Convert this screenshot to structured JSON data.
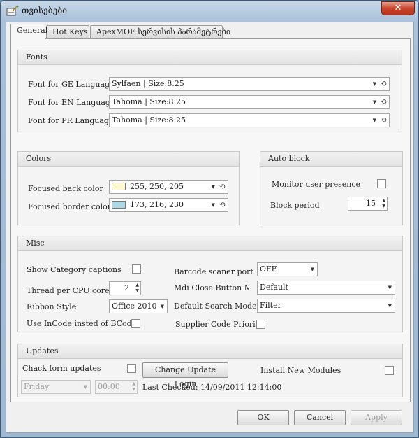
{
  "window": {
    "title": "თვისებები",
    "close_label": "✕"
  },
  "tabs": [
    "General",
    "Hot Keys",
    "ApexMOF სერვისის პარამეტრები"
  ],
  "fonts": {
    "header": "Fonts",
    "rows": [
      {
        "label": "Font for GE Language",
        "value": "Sylfaen | Size:8.25"
      },
      {
        "label": "Font for EN Language",
        "value": "Tahoma | Size:8.25"
      },
      {
        "label": "Font for PR Language",
        "value": "Tahoma | Size:8.25"
      }
    ]
  },
  "colors": {
    "header": "Colors",
    "rows": [
      {
        "label": "Focused back color",
        "value": "255, 250, 205",
        "swatch": "#fffacd"
      },
      {
        "label": "Focused border color",
        "value": "173, 216, 230",
        "swatch": "#add8e6"
      }
    ]
  },
  "auto_block": {
    "header": "Auto block",
    "monitor_label": "Monitor user presence",
    "period_label": "Block period",
    "period_value": "15"
  },
  "misc": {
    "header": "Misc",
    "show_category_label": "Show Category captions",
    "thread_label": "Thread per CPU core",
    "thread_value": "2",
    "ribbon_label": "Ribbon Style",
    "ribbon_value": "Office 2010",
    "incode_label": "Use InCode insted of BCode",
    "barcode_label": "Barcode scaner port",
    "barcode_value": "OFF",
    "mdi_label": "Mdi Close Button Mode",
    "mdi_value": "Default",
    "search_label": "Default Search Mode",
    "search_value": "Filter",
    "supplier_label": "Supplier Code Priority"
  },
  "updates": {
    "header": "Updates",
    "check_label": "Chack form updates",
    "change_login_label": "Change Update Login",
    "install_label": "Install New Modules",
    "day_value": "Friday",
    "time_value": "00:00",
    "last_checked": "Last Checked: 14/09/2011 12:14:00"
  },
  "footer": {
    "ok": "OK",
    "cancel": "Cancel",
    "apply": "Apply"
  }
}
